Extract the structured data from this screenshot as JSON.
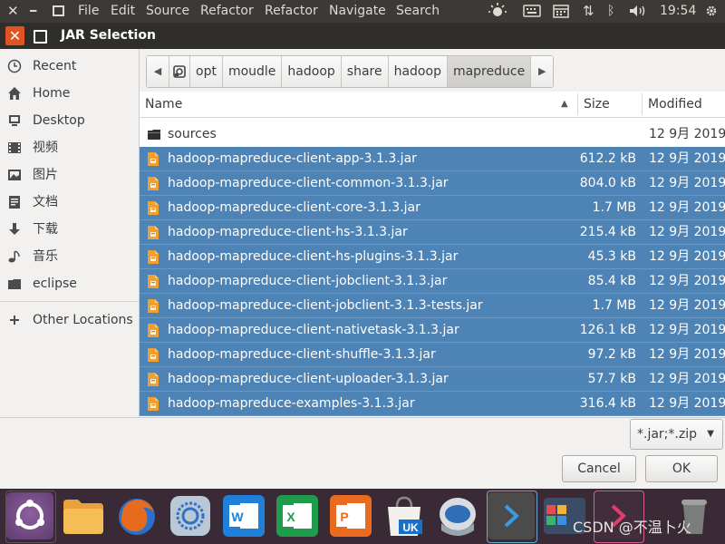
{
  "topbar": {
    "menu": [
      "File",
      "Edit",
      "Source",
      "Refactor",
      "Refactor",
      "Navigate",
      "Search"
    ],
    "clock": "19:54"
  },
  "dialog": {
    "title": "JAR Selection"
  },
  "sidebar": {
    "items": [
      {
        "label": "Recent",
        "icon": "clock-icon"
      },
      {
        "label": "Home",
        "icon": "home-icon"
      },
      {
        "label": "Desktop",
        "icon": "desktop-icon"
      },
      {
        "label": "视频",
        "icon": "video-icon"
      },
      {
        "label": "图片",
        "icon": "picture-icon"
      },
      {
        "label": "文档",
        "icon": "document-icon"
      },
      {
        "label": "下载",
        "icon": "download-icon"
      },
      {
        "label": "音乐",
        "icon": "music-icon"
      },
      {
        "label": "eclipse",
        "icon": "folder-icon"
      }
    ],
    "other": {
      "label": "Other Locations",
      "icon": "plus-icon"
    }
  },
  "pathbar": {
    "segments": [
      "opt",
      "moudle",
      "hadoop",
      "share",
      "hadoop",
      "mapreduce"
    ],
    "active_index": 5
  },
  "list": {
    "headers": {
      "name": "Name",
      "size": "Size",
      "modified": "Modified"
    },
    "sort": "ascending",
    "folder": {
      "name": "sources",
      "modified": "12 9月 2019"
    },
    "files": [
      {
        "name": "hadoop-mapreduce-client-app-3.1.3.jar",
        "size": "612.2 kB",
        "modified": "12 9月 2019"
      },
      {
        "name": "hadoop-mapreduce-client-common-3.1.3.jar",
        "size": "804.0 kB",
        "modified": "12 9月 2019"
      },
      {
        "name": "hadoop-mapreduce-client-core-3.1.3.jar",
        "size": "1.7 MB",
        "modified": "12 9月 2019"
      },
      {
        "name": "hadoop-mapreduce-client-hs-3.1.3.jar",
        "size": "215.4 kB",
        "modified": "12 9月 2019"
      },
      {
        "name": "hadoop-mapreduce-client-hs-plugins-3.1.3.jar",
        "size": "45.3 kB",
        "modified": "12 9月 2019"
      },
      {
        "name": "hadoop-mapreduce-client-jobclient-3.1.3.jar",
        "size": "85.4 kB",
        "modified": "12 9月 2019"
      },
      {
        "name": "hadoop-mapreduce-client-jobclient-3.1.3-tests.jar",
        "size": "1.7 MB",
        "modified": "12 9月 2019"
      },
      {
        "name": "hadoop-mapreduce-client-nativetask-3.1.3.jar",
        "size": "126.1 kB",
        "modified": "12 9月 2019"
      },
      {
        "name": "hadoop-mapreduce-client-shuffle-3.1.3.jar",
        "size": "97.2 kB",
        "modified": "12 9月 2019"
      },
      {
        "name": "hadoop-mapreduce-client-uploader-3.1.3.jar",
        "size": "57.7 kB",
        "modified": "12 9月 2019"
      },
      {
        "name": "hadoop-mapreduce-examples-3.1.3.jar",
        "size": "316.4 kB",
        "modified": "12 9月 2019"
      }
    ]
  },
  "filter": {
    "value": "*.jar;*.zip"
  },
  "buttons": {
    "cancel": "Cancel",
    "ok": "OK"
  },
  "dock": {
    "apps": [
      "ubuntu-icon",
      "files-icon",
      "firefox-icon",
      "browser-icon",
      "writer-icon",
      "calc-icon",
      "impress-icon",
      "software-center-icon",
      "installer-icon",
      "vscode-icon",
      "screenshot-icon",
      "terminal-icon",
      "trash-icon"
    ]
  },
  "watermark": "CSDN @不温卜火",
  "colors": {
    "selection": "#4e83b5",
    "topbar": "#3b3a36",
    "dock": "#3a2a36",
    "close": "#e0541f"
  }
}
